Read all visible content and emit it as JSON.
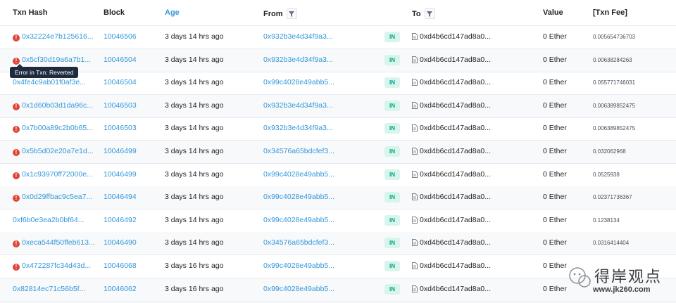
{
  "headers": {
    "txn_hash": "Txn Hash",
    "block": "Block",
    "age": "Age",
    "from": "From",
    "to": "To",
    "value": "Value",
    "txn_fee": "[Txn Fee]"
  },
  "tooltip": "Error in Txn: Reverted",
  "rows": [
    {
      "hash": "0x32224e7b125616...",
      "error": true,
      "block": "10046506",
      "age": "3 days 14 hrs ago",
      "from": "0x932b3e4d34f9a3...",
      "dir": "IN",
      "to": "0xd4b6cd147ad8a0...",
      "value": "0 Ether",
      "fee": "0.005654736703"
    },
    {
      "hash": "0x5cf30d19a6a7b1...",
      "error": true,
      "block": "10046504",
      "age": "3 days 14 hrs ago",
      "from": "0x932b3e4d34f9a3...",
      "dir": "IN",
      "to": "0xd4b6cd147ad8a0...",
      "value": "0 Ether",
      "fee": "0.00638284263"
    },
    {
      "hash": "0x4fe4c9ab01f0af3e...",
      "error": false,
      "block": "10046504",
      "age": "3 days 14 hrs ago",
      "from": "0x99c4028e49abb5...",
      "dir": "IN",
      "to": "0xd4b6cd147ad8a0...",
      "value": "0 Ether",
      "fee": "0.055771746031"
    },
    {
      "hash": "0x1d60b03d1da96c...",
      "error": true,
      "block": "10046503",
      "age": "3 days 14 hrs ago",
      "from": "0x932b3e4d34f9a3...",
      "dir": "IN",
      "to": "0xd4b6cd147ad8a0...",
      "value": "0 Ether",
      "fee": "0.006389852475"
    },
    {
      "hash": "0x7b00a89c2b0b65...",
      "error": true,
      "block": "10046503",
      "age": "3 days 14 hrs ago",
      "from": "0x932b3e4d34f9a3...",
      "dir": "IN",
      "to": "0xd4b6cd147ad8a0...",
      "value": "0 Ether",
      "fee": "0.006389852475"
    },
    {
      "hash": "0x5b5d02e20a7e1d...",
      "error": true,
      "block": "10046499",
      "age": "3 days 14 hrs ago",
      "from": "0x34576a65bdcfef3...",
      "dir": "IN",
      "to": "0xd4b6cd147ad8a0...",
      "value": "0 Ether",
      "fee": "0.032062968"
    },
    {
      "hash": "0x1c93970ff72000e...",
      "error": true,
      "block": "10046499",
      "age": "3 days 14 hrs ago",
      "from": "0x99c4028e49abb5...",
      "dir": "IN",
      "to": "0xd4b6cd147ad8a0...",
      "value": "0 Ether",
      "fee": "0.0525938"
    },
    {
      "hash": "0x0d29ffbac9c5ea7...",
      "error": true,
      "block": "10046494",
      "age": "3 days 14 hrs ago",
      "from": "0x99c4028e49abb5...",
      "dir": "IN",
      "to": "0xd4b6cd147ad8a0...",
      "value": "0 Ether",
      "fee": "0.02371736367"
    },
    {
      "hash": "0xf6b0e3ea2b0bf64...",
      "error": false,
      "block": "10046492",
      "age": "3 days 14 hrs ago",
      "from": "0x99c4028e49abb5...",
      "dir": "IN",
      "to": "0xd4b6cd147ad8a0...",
      "value": "0 Ether",
      "fee": "0.1238134"
    },
    {
      "hash": "0xeca544f50ffeb613...",
      "error": true,
      "block": "10046490",
      "age": "3 days 14 hrs ago",
      "from": "0x34576a65bdcfef3...",
      "dir": "IN",
      "to": "0xd4b6cd147ad8a0...",
      "value": "0 Ether",
      "fee": "0.0316414404"
    },
    {
      "hash": "0x472287fc34d43d...",
      "error": true,
      "block": "10046068",
      "age": "3 days 16 hrs ago",
      "from": "0x99c4028e49abb5...",
      "dir": "IN",
      "to": "0xd4b6cd147ad8a0...",
      "value": "0 Ether",
      "fee": ""
    },
    {
      "hash": "0x82814ec71c56b5f...",
      "error": false,
      "block": "10046062",
      "age": "3 days 16 hrs ago",
      "from": "0x99c4028e49abb5...",
      "dir": "IN",
      "to": "0xd4b6cd147ad8a0...",
      "value": "0 Ether",
      "fee": ""
    }
  ],
  "watermark": {
    "text": "得岸观点",
    "site": "www.jk260.com"
  },
  "colors": {
    "link": "#3498db",
    "error": "#de4437",
    "badge_bg": "#d7f5ec",
    "badge_fg": "#00a186"
  }
}
